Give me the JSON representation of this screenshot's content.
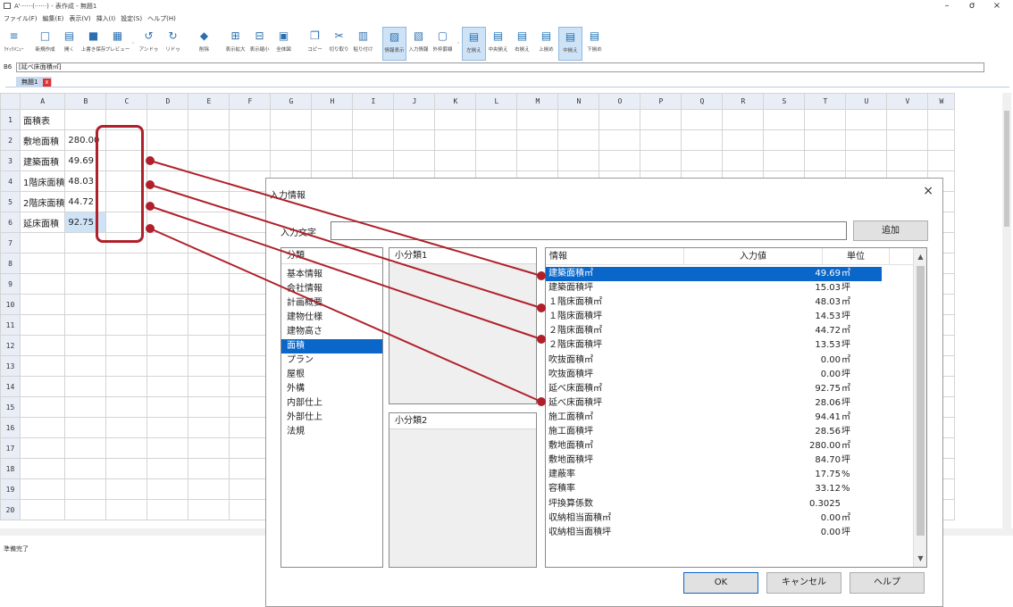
{
  "window": {
    "title": "A'\u0000\u0000\u0000\u0000\u0000\u0000(\u0000\u0000\u0000\u0000\u0000\u0000) - 表作成 - 無題1",
    "title_display": "A'······(······) - 表作成 - 無題1",
    "minimize": "–",
    "maximize": "σ",
    "close": "×"
  },
  "menu": [
    "ファイル(F)",
    "編集(E)",
    "表示(V)",
    "挿入(I)",
    "設定(S)",
    "ヘルプ(H)"
  ],
  "toolbar": [
    {
      "label": "ｸｲｯｸﾒﾆｭｰ",
      "icon": "hamburger-icon"
    },
    {
      "label": "新規作成",
      "icon": "new-file-icon"
    },
    {
      "label": "開く",
      "icon": "open-folder-icon"
    },
    {
      "label": "上書き保存",
      "icon": "save-icon"
    },
    {
      "label": "プレビュー",
      "icon": "print-preview-icon"
    },
    {
      "label": "アンドゥ",
      "icon": "undo-icon"
    },
    {
      "label": "リドゥ",
      "icon": "redo-icon"
    },
    {
      "label": "削除",
      "icon": "eraser-icon"
    },
    {
      "label": "表示拡大",
      "icon": "zoom-in-icon"
    },
    {
      "label": "表示縮小",
      "icon": "zoom-out-icon"
    },
    {
      "label": "全体図",
      "icon": "fit-view-icon"
    },
    {
      "label": "コピー",
      "icon": "copy-icon"
    },
    {
      "label": "切り取り",
      "icon": "cut-icon"
    },
    {
      "label": "貼り付け",
      "icon": "paste-icon"
    },
    {
      "label": "情報表示",
      "icon": "info-display-icon",
      "active": true
    },
    {
      "label": "入力情報",
      "icon": "input-info-icon"
    },
    {
      "label": "外枠罫線",
      "icon": "border-icon"
    },
    {
      "label": "左揃え",
      "icon": "align-left-icon",
      "active": true
    },
    {
      "label": "中央揃え",
      "icon": "align-center-icon"
    },
    {
      "label": "右揃え",
      "icon": "align-right-icon"
    },
    {
      "label": "上揃め",
      "icon": "align-top-icon"
    },
    {
      "label": "中揃え",
      "icon": "align-middle-icon",
      "active": true
    },
    {
      "label": "下揃め",
      "icon": "align-bottom-icon"
    }
  ],
  "formula_bar": {
    "cell_ref": "B6",
    "content": "[延べ床面積㎡]"
  },
  "sheet_tab": {
    "name": "無題1",
    "close": "x"
  },
  "columns": [
    "A",
    "B",
    "C",
    "D",
    "E",
    "F",
    "G",
    "H",
    "I",
    "J",
    "K",
    "L",
    "M",
    "N",
    "O",
    "P",
    "Q",
    "R",
    "S",
    "T",
    "U",
    "V",
    "W"
  ],
  "rows": [
    {
      "num": "1",
      "a": "面積表",
      "b": ""
    },
    {
      "num": "2",
      "a": "敷地面積",
      "b": "280.00"
    },
    {
      "num": "3",
      "a": "建築面積",
      "b": "49.69"
    },
    {
      "num": "4",
      "a": "1階床面積",
      "b": "48.03"
    },
    {
      "num": "5",
      "a": "2階床面積",
      "b": "44.72"
    },
    {
      "num": "6",
      "a": "延床面積",
      "b": "92.75"
    },
    {
      "num": "7",
      "a": "",
      "b": ""
    },
    {
      "num": "8",
      "a": "",
      "b": ""
    },
    {
      "num": "9",
      "a": "",
      "b": ""
    },
    {
      "num": "10",
      "a": "",
      "b": ""
    },
    {
      "num": "11",
      "a": "",
      "b": ""
    },
    {
      "num": "12",
      "a": "",
      "b": ""
    },
    {
      "num": "13",
      "a": "",
      "b": ""
    },
    {
      "num": "14",
      "a": "",
      "b": ""
    },
    {
      "num": "15",
      "a": "",
      "b": ""
    },
    {
      "num": "16",
      "a": "",
      "b": ""
    },
    {
      "num": "17",
      "a": "",
      "b": ""
    },
    {
      "num": "18",
      "a": "",
      "b": ""
    },
    {
      "num": "19",
      "a": "",
      "b": ""
    },
    {
      "num": "20",
      "a": "",
      "b": ""
    }
  ],
  "status": "準備完了",
  "dialog": {
    "title": "入力情報",
    "close": "×",
    "input_label": "入力文字",
    "input_value": "",
    "add_button": "追加",
    "category_header": "分類",
    "categories": [
      "基本情報",
      "会社情報",
      "計画概要",
      "建物仕様",
      "建物高さ",
      "面積",
      "プラン",
      "屋根",
      "外構",
      "内部仕上",
      "外部仕上",
      "法規"
    ],
    "selected_category": "面積",
    "sub1_header": "小分類1",
    "sub2_header": "小分類2",
    "info_headers": {
      "name": "情報",
      "value": "入力値",
      "unit": "単位"
    },
    "info_rows": [
      {
        "name": "建築面積㎡",
        "value": "49.69",
        "unit": "㎡",
        "selected": true
      },
      {
        "name": "建築面積坪",
        "value": "15.03",
        "unit": "坪"
      },
      {
        "name": "１階床面積㎡",
        "value": "48.03",
        "unit": "㎡"
      },
      {
        "name": "１階床面積坪",
        "value": "14.53",
        "unit": "坪"
      },
      {
        "name": "２階床面積㎡",
        "value": "44.72",
        "unit": "㎡"
      },
      {
        "name": "２階床面積坪",
        "value": "13.53",
        "unit": "坪"
      },
      {
        "name": "吹抜面積㎡",
        "value": "0.00",
        "unit": "㎡"
      },
      {
        "name": "吹抜面積坪",
        "value": "0.00",
        "unit": "坪"
      },
      {
        "name": "延べ床面積㎡",
        "value": "92.75",
        "unit": "㎡"
      },
      {
        "name": "延べ床面積坪",
        "value": "28.06",
        "unit": "坪"
      },
      {
        "name": "施工面積㎡",
        "value": "94.41",
        "unit": "㎡"
      },
      {
        "name": "施工面積坪",
        "value": "28.56",
        "unit": "坪"
      },
      {
        "name": "敷地面積㎡",
        "value": "280.00",
        "unit": "㎡"
      },
      {
        "name": "敷地面積坪",
        "value": "84.70",
        "unit": "坪"
      },
      {
        "name": "建蔽率",
        "value": "17.75",
        "unit": "%"
      },
      {
        "name": "容積率",
        "value": "33.12",
        "unit": "%"
      },
      {
        "name": "坪換算係数",
        "value": "0.3025",
        "unit": ""
      },
      {
        "name": "収納相当面積㎡",
        "value": "0.00",
        "unit": "㎡"
      },
      {
        "name": "収納相当面積坪",
        "value": "0.00",
        "unit": "坪"
      }
    ],
    "ok": "OK",
    "cancel": "キャンセル",
    "help": "ヘルプ"
  },
  "colors": {
    "highlight": "#b0202a",
    "selection": "#0a66c8",
    "header_bg": "#e9eef6"
  }
}
